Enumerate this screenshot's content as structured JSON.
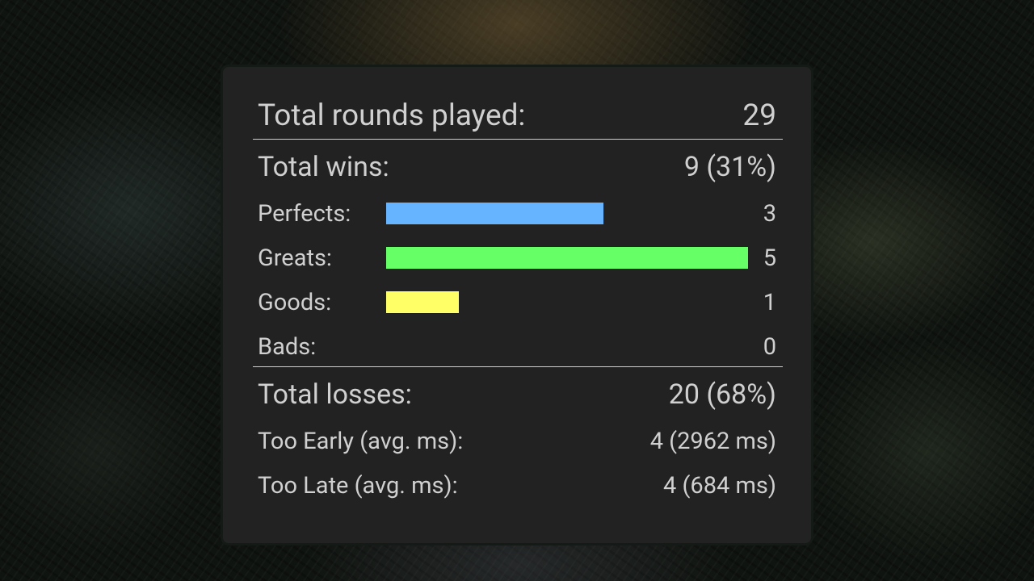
{
  "stats": {
    "total_rounds": {
      "label": "Total rounds played:",
      "value": "29"
    },
    "total_wins": {
      "label": "Total wins:",
      "value": "9 (31%)"
    },
    "perfects": {
      "label": "Perfects:",
      "value": "3",
      "count": 3,
      "color": "#66b3ff"
    },
    "greats": {
      "label": "Greats:",
      "value": "5",
      "count": 5,
      "color": "#66ff66"
    },
    "goods": {
      "label": "Goods:",
      "value": "1",
      "count": 1,
      "color": "#ffff66"
    },
    "bads": {
      "label": "Bads:",
      "value": "0",
      "count": 0,
      "color": "#ff6666"
    },
    "total_losses": {
      "label": "Total losses:",
      "value": "20 (68%)"
    },
    "too_early": {
      "label": "Too Early (avg. ms):",
      "value": "4 (2962 ms)"
    },
    "too_late": {
      "label": "Too Late (avg. ms):",
      "value": "4 (684 ms)"
    }
  }
}
